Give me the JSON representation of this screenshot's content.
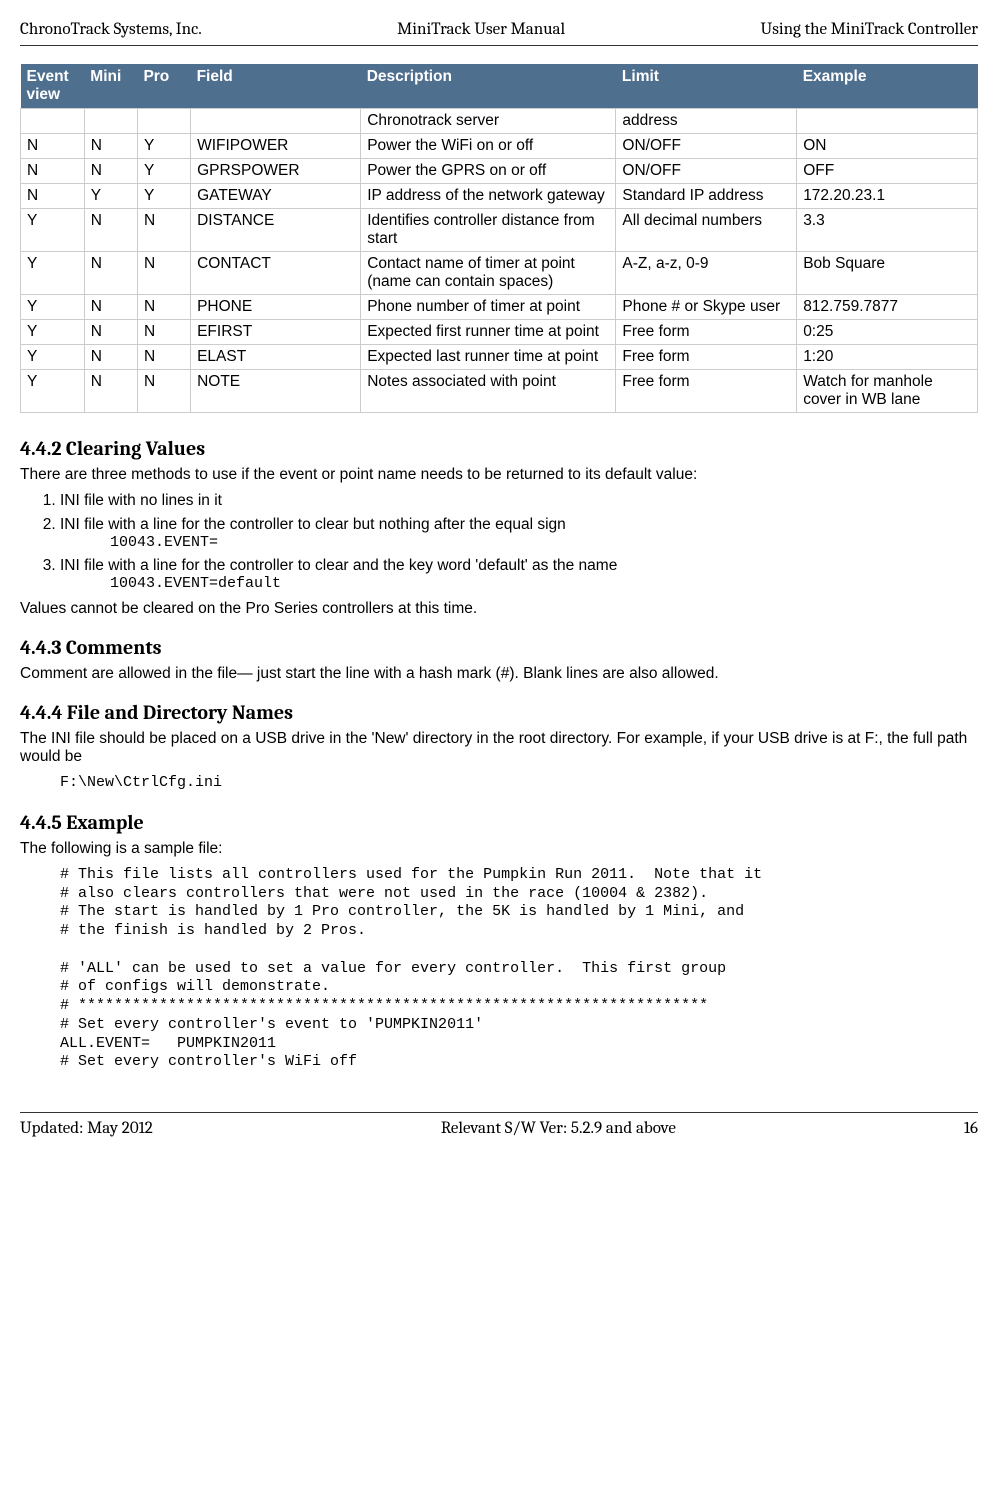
{
  "header": {
    "left": "ChronoTrack Systems, Inc.",
    "center": "MiniTrack User Manual",
    "right": "Using the MiniTrack Controller"
  },
  "table": {
    "headers": [
      "Event view",
      "Mini",
      "Pro",
      "Field",
      "Description",
      "Limit",
      "Example"
    ],
    "rows": [
      [
        "",
        "",
        "",
        "",
        "Chronotrack server",
        "address",
        ""
      ],
      [
        "N",
        "N",
        "Y",
        "WIFIPOWER",
        "Power the WiFi on or off",
        "ON/OFF",
        "ON"
      ],
      [
        "N",
        "N",
        "Y",
        "GPRSPOWER",
        "Power the GPRS on or off",
        "ON/OFF",
        "OFF"
      ],
      [
        "N",
        "Y",
        "Y",
        "GATEWAY",
        "IP address of the network gateway",
        "Standard IP address",
        "172.20.23.1"
      ],
      [
        "Y",
        "N",
        "N",
        "DISTANCE",
        "Identifies controller distance from start",
        "All decimal numbers",
        "3.3"
      ],
      [
        "Y",
        "N",
        "N",
        "CONTACT",
        "Contact name of timer at point (name can contain spaces)",
        "A-Z, a-z, 0-9",
        "Bob Square"
      ],
      [
        "Y",
        "N",
        "N",
        "PHONE",
        "Phone number of timer at point",
        "Phone # or Skype user",
        "812.759.7877"
      ],
      [
        "Y",
        "N",
        "N",
        "EFIRST",
        "Expected first runner time at point",
        "Free form",
        "0:25"
      ],
      [
        "Y",
        "N",
        "N",
        "ELAST",
        "Expected last runner time at point",
        "Free form",
        "1:20"
      ],
      [
        "Y",
        "N",
        "N",
        "NOTE",
        "Notes associated with point",
        "Free form",
        "Watch for manhole cover in WB lane"
      ]
    ]
  },
  "sections": {
    "s1": {
      "heading": "4.4.2   Clearing Values",
      "intro": "There are three methods to use if the event or point name needs to be returned to its default value:",
      "li1": "INI file with no lines in it",
      "li2": "INI file with a line for the controller to clear but nothing after the equal sign",
      "li2code": "10043.EVENT=",
      "li3": "INI file with a line for the controller to clear and the key word 'default' as the name",
      "li3code": "10043.EVENT=default",
      "outro": "Values cannot be cleared on the Pro Series controllers at this time."
    },
    "s2": {
      "heading": "4.4.3   Comments",
      "p": "Comment are allowed in the file— just start the line with a hash mark (#).  Blank lines are also allowed."
    },
    "s3": {
      "heading": "4.4.4   File and Directory Names",
      "p": "The INI file should be placed on a USB drive in the 'New' directory in the root directory.  For example, if your USB drive is at F:, the full path would be",
      "code": "F:\\New\\CtrlCfg.ini"
    },
    "s4": {
      "heading": "4.4.5   Example",
      "intro": "The following is a sample file:",
      "code": "# This file lists all controllers used for the Pumpkin Run 2011.  Note that it\n# also clears controllers that were not used in the race (10004 & 2382).\n# The start is handled by 1 Pro controller, the 5K is handled by 1 Mini, and\n# the finish is handled by 2 Pros.\n\n# 'ALL' can be used to set a value for every controller.  This first group\n# of configs will demonstrate.\n# **********************************************************************\n# Set every controller's event to 'PUMPKIN2011'\nALL.EVENT=   PUMPKIN2011\n# Set every controller's WiFi off"
    }
  },
  "footer": {
    "left": "Updated: May 2012",
    "center": "Relevant S/W Ver: 5.2.9 and above",
    "right": "16"
  }
}
